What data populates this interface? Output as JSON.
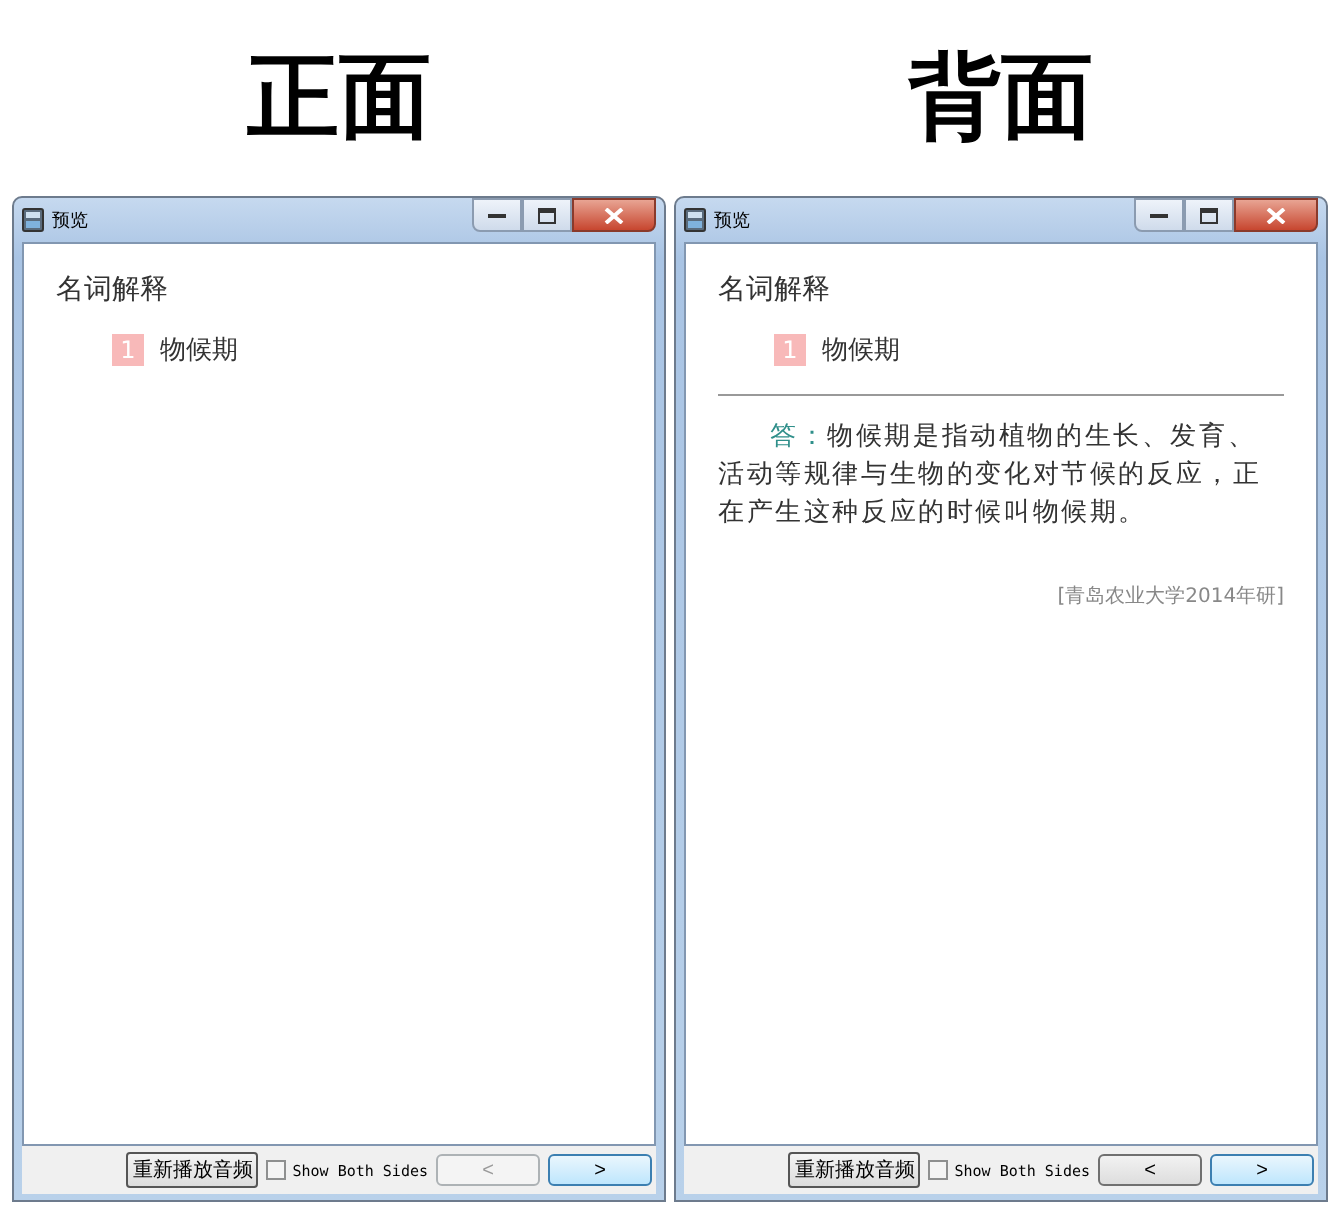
{
  "pages": [
    {
      "heading": "正面",
      "window": {
        "title": "预览"
      },
      "section": "名词解释",
      "item": {
        "number": "1",
        "term": "物候期"
      },
      "footer": {
        "replay_button": "重新播放音频",
        "checkbox": {
          "label": "Show Both Sides",
          "checked": false
        },
        "prev_button": {
          "label": "<",
          "disabled": true
        },
        "next_button": {
          "label": ">",
          "disabled": false
        }
      }
    },
    {
      "heading": "背面",
      "window": {
        "title": "预览"
      },
      "section": "名词解释",
      "item": {
        "number": "1",
        "term": "物候期"
      },
      "answer": {
        "label": "答：",
        "text": "物候期是指动植物的生长、发育、活动等规律与生物的变化对节候的反应，正在产生这种反应的时候叫物候期。",
        "source": "[青岛农业大学2014年研]"
      },
      "footer": {
        "replay_button": "重新播放音频",
        "checkbox": {
          "label": "Show Both Sides",
          "checked": false
        },
        "prev_button": {
          "label": "<",
          "disabled": false
        },
        "next_button": {
          "label": ">",
          "disabled": false
        }
      }
    }
  ]
}
